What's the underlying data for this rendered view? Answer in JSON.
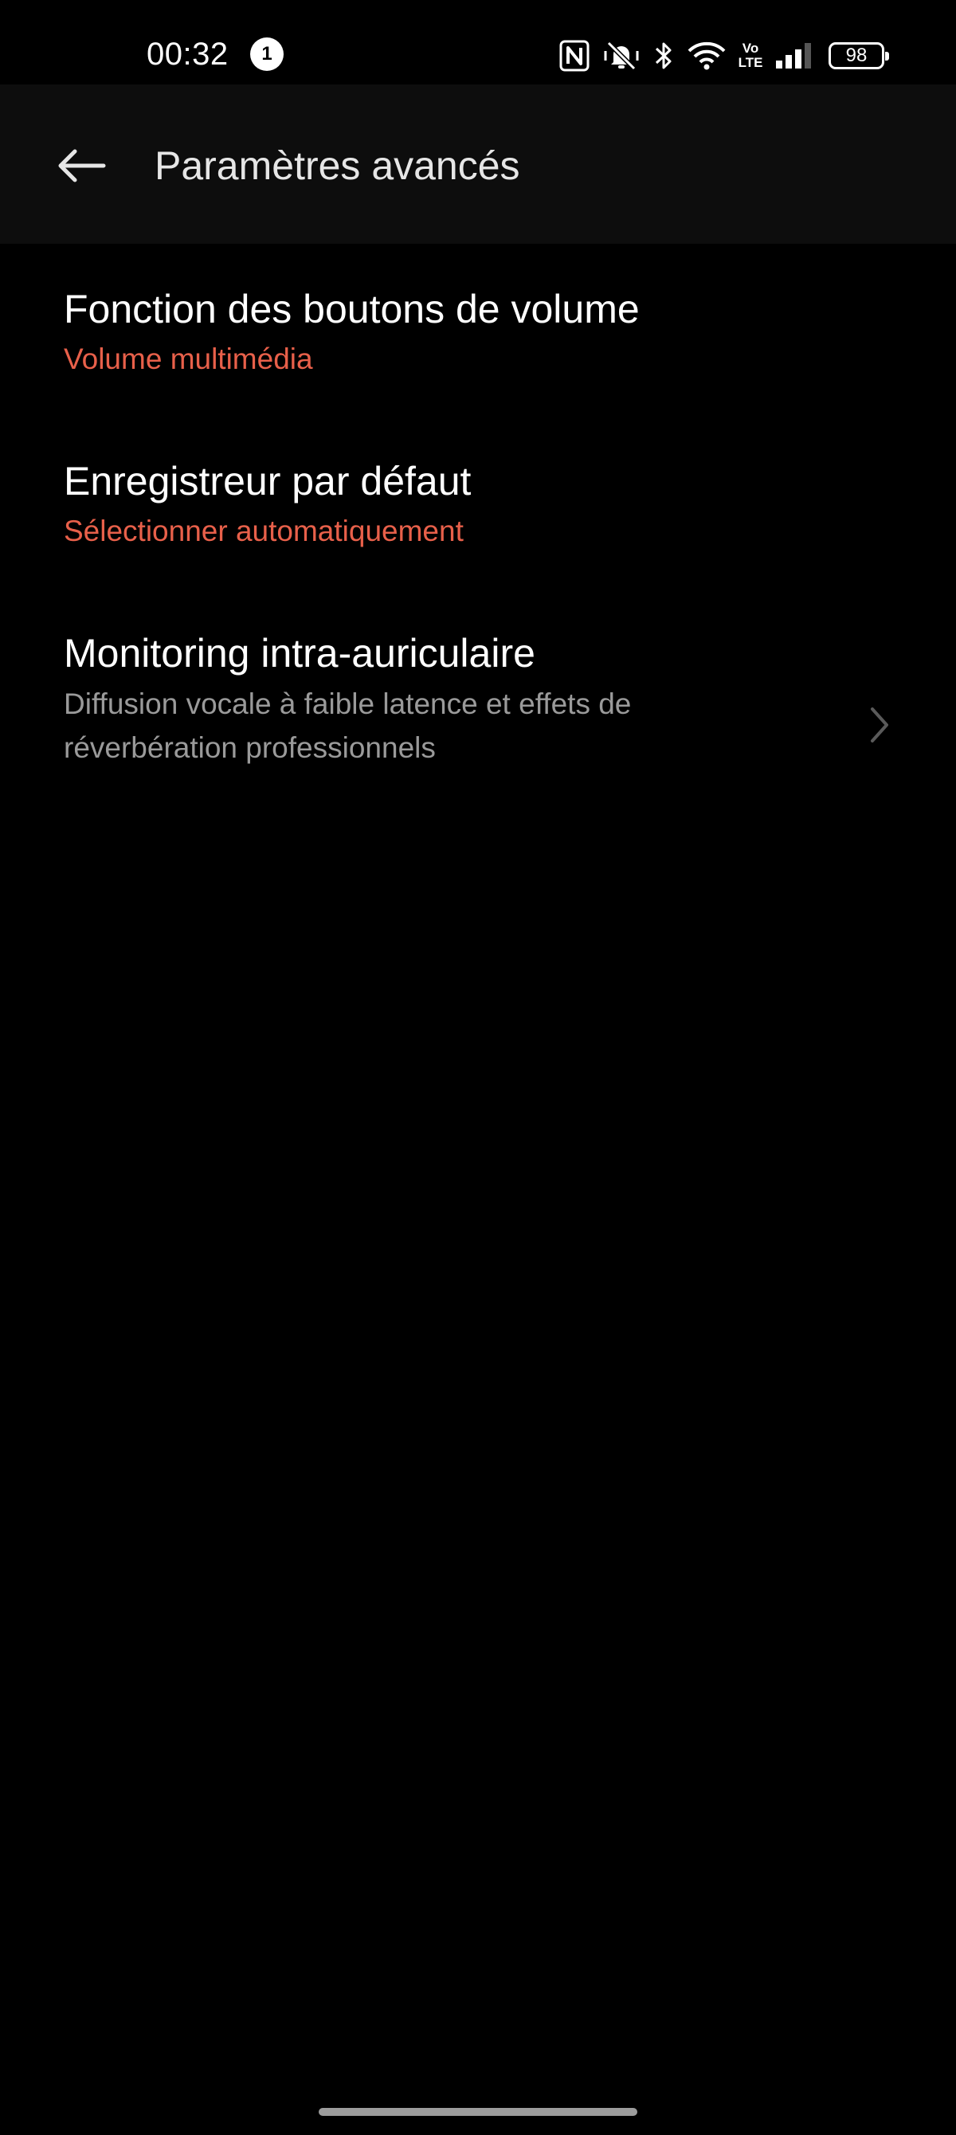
{
  "status_bar": {
    "time": "00:32",
    "notification_count": "1",
    "battery": "98",
    "icons": [
      "nfc-icon",
      "vibrate-silent-icon",
      "bluetooth-icon",
      "wifi-icon",
      "volte-icon",
      "signal-icon",
      "battery-icon"
    ],
    "volte_top": "Vo",
    "volte_bottom": "LTE"
  },
  "app_bar": {
    "title": "Paramètres avancés",
    "back_icon": "arrow-left-icon"
  },
  "settings": {
    "items": [
      {
        "title": "Fonction des boutons de volume",
        "value": "Volume multimédia"
      },
      {
        "title": "Enregistreur par défaut",
        "value": "Sélectionner automatiquement"
      },
      {
        "title": "Monitoring intra-auriculaire",
        "description": "Diffusion vocale à faible latence et effets de réverbération professionnels",
        "trailing_icon": "chevron-right-icon"
      }
    ]
  },
  "colors": {
    "background": "#000000",
    "app_bar": "#0d0d0d",
    "accent": "#e8604a",
    "secondary_text": "#9a9a9a"
  }
}
